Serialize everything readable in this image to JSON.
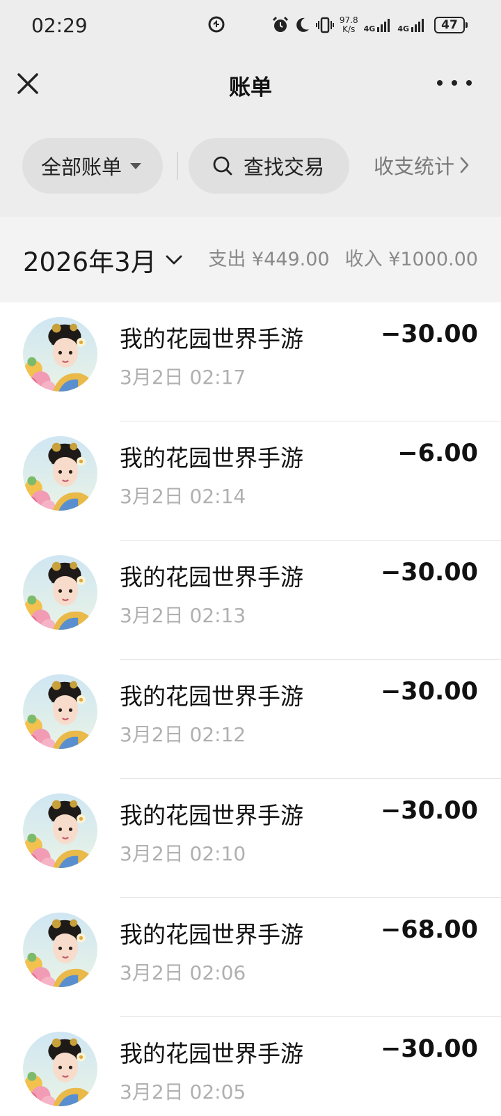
{
  "status_bar": {
    "time": "02:29",
    "speed_value": "97.8",
    "speed_unit": "K/s",
    "net1": "4G",
    "net2": "4G",
    "battery": "47"
  },
  "nav": {
    "title": "账单"
  },
  "filters": {
    "all_bills": "全部账单",
    "search": "查找交易",
    "stats": "收支统计"
  },
  "month": {
    "label": "2026年3月",
    "expense": "支出 ¥449.00",
    "income": "收入 ¥1000.00"
  },
  "transactions": [
    {
      "title": "我的花园世界手游",
      "time": "3月2日 02:17",
      "amount": "−30.00"
    },
    {
      "title": "我的花园世界手游",
      "time": "3月2日 02:14",
      "amount": "−6.00"
    },
    {
      "title": "我的花园世界手游",
      "time": "3月2日 02:13",
      "amount": "−30.00"
    },
    {
      "title": "我的花园世界手游",
      "time": "3月2日 02:12",
      "amount": "−30.00"
    },
    {
      "title": "我的花园世界手游",
      "time": "3月2日 02:10",
      "amount": "−30.00"
    },
    {
      "title": "我的花园世界手游",
      "time": "3月2日 02:06",
      "amount": "−68.00"
    },
    {
      "title": "我的花园世界手游",
      "time": "3月2日 02:05",
      "amount": "−30.00"
    }
  ]
}
